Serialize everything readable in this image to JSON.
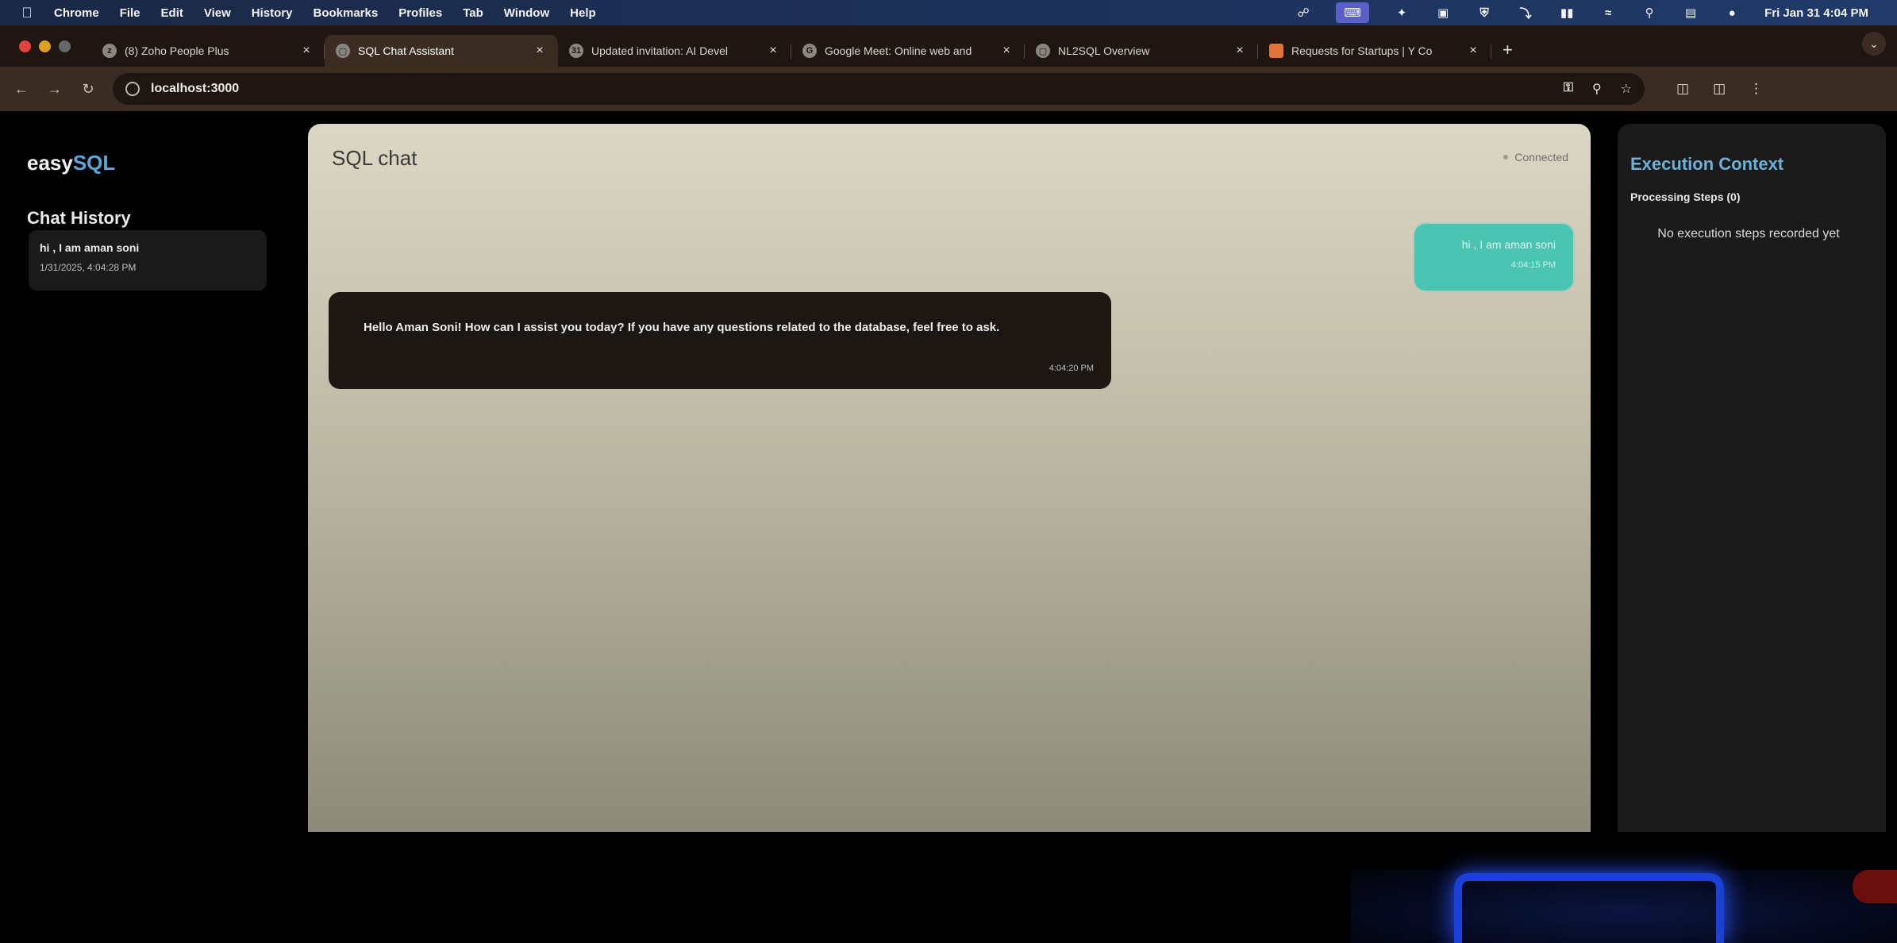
{
  "menubar": {
    "apple": "",
    "items": [
      "Chrome",
      "File",
      "Edit",
      "View",
      "History",
      "Bookmarks",
      "Profiles",
      "Tab",
      "Window",
      "Help"
    ],
    "status_icons": [
      "sync-icon",
      "keyboard-icon",
      "malwarebytes-icon",
      "document-icon",
      "shield-icon",
      "bluetooth-icon",
      "battery-icon",
      "wifi-icon",
      "search-icon",
      "control-center-icon",
      "siri-icon"
    ],
    "clock": "Fri Jan 31  4:04 PM"
  },
  "tabs": [
    {
      "title": "(8) Zoho People Plus",
      "active": false
    },
    {
      "title": "SQL Chat Assistant",
      "active": true
    },
    {
      "title": "Updated invitation: AI Devel",
      "active": false
    },
    {
      "title": "Google Meet: Online web and",
      "active": false
    },
    {
      "title": "NL2SQL Overview",
      "active": false
    },
    {
      "title": "Requests for Startups | Y Co",
      "active": false
    }
  ],
  "toolbar": {
    "url": "localhost:3000"
  },
  "sidebar": {
    "brand_main": "easy",
    "brand_accent": "SQL",
    "history_title": "Chat History",
    "history_items": [
      {
        "title": "hi , I am aman soni",
        "time": "1/31/2025, 4:04:28 PM"
      }
    ]
  },
  "chat": {
    "title": "SQL chat",
    "status": "Connected",
    "messages": [
      {
        "role": "user",
        "text": "hi , I am aman soni",
        "time": "4:04:15 PM"
      },
      {
        "role": "assistant",
        "text": "Hello Aman Soni! How can I assist you today? If you have any questions related to the database, feel free to ask.",
        "time": "4:04:20 PM"
      }
    ]
  },
  "context": {
    "title": "Execution Context",
    "steps_label": "Processing Steps (0)",
    "empty_text": "No execution steps recorded yet"
  },
  "colors": {
    "accent": "#5da7d8",
    "user_bubble": "#4cc4b2",
    "assistant_bubble": "#1c1713"
  }
}
